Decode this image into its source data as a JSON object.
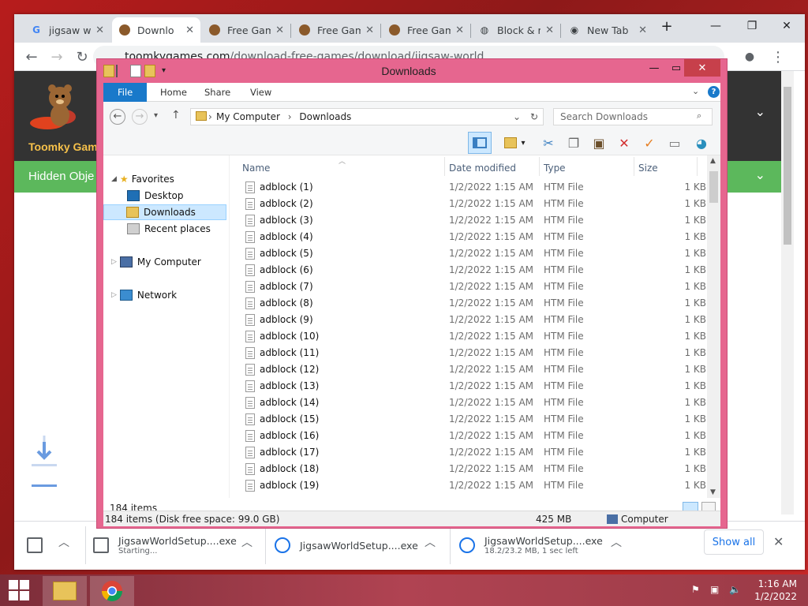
{
  "browser": {
    "tabs": [
      {
        "title": "jigsaw w",
        "icon": "google-icon"
      },
      {
        "title": "Downlo",
        "icon": "bear-icon"
      },
      {
        "title": "Free Gam",
        "icon": "bear-icon"
      },
      {
        "title": "Free Gam",
        "icon": "bear-icon"
      },
      {
        "title": "Free Gam",
        "icon": "bear-icon"
      },
      {
        "title": "Block & r",
        "icon": "globe-icon"
      },
      {
        "title": "New Tab",
        "icon": "chrome-icon"
      }
    ],
    "url_host": "toomkygames.com",
    "url_path": "/download-free-games/download/jigsaw-world",
    "site_name": "Toomky Gam",
    "site_nav_label": "Hidden Obje"
  },
  "downloads_shelf": {
    "items": [
      {
        "name": "JigsawWorldSetup....exe",
        "status": "Starting..."
      },
      {
        "name": "JigsawWorldSetup....exe",
        "status": ""
      },
      {
        "name": "JigsawWorldSetup....exe",
        "status": "18.2/23.2 MB, 1 sec left"
      }
    ],
    "show_all_label": "Show all"
  },
  "explorer": {
    "title": "Downloads",
    "ribbon_tabs": [
      "File",
      "Home",
      "Share",
      "View"
    ],
    "breadcrumb": [
      "My Computer",
      "Downloads"
    ],
    "search_placeholder": "Search Downloads",
    "nav": {
      "favorites": "Favorites",
      "desktop": "Desktop",
      "downloads": "Downloads",
      "recent": "Recent places",
      "computer": "My Computer",
      "network": "Network"
    },
    "columns": {
      "name": "Name",
      "date": "Date modified",
      "type": "Type",
      "size": "Size"
    },
    "files": [
      {
        "name": "adblock (1)",
        "date": "1/2/2022 1:15 AM",
        "type": "HTM File",
        "size": "1 KB"
      },
      {
        "name": "adblock (2)",
        "date": "1/2/2022 1:15 AM",
        "type": "HTM File",
        "size": "1 KB"
      },
      {
        "name": "adblock (3)",
        "date": "1/2/2022 1:15 AM",
        "type": "HTM File",
        "size": "1 KB"
      },
      {
        "name": "adblock (4)",
        "date": "1/2/2022 1:15 AM",
        "type": "HTM File",
        "size": "1 KB"
      },
      {
        "name": "adblock (5)",
        "date": "1/2/2022 1:15 AM",
        "type": "HTM File",
        "size": "1 KB"
      },
      {
        "name": "adblock (6)",
        "date": "1/2/2022 1:15 AM",
        "type": "HTM File",
        "size": "1 KB"
      },
      {
        "name": "adblock (7)",
        "date": "1/2/2022 1:15 AM",
        "type": "HTM File",
        "size": "1 KB"
      },
      {
        "name": "adblock (8)",
        "date": "1/2/2022 1:15 AM",
        "type": "HTM File",
        "size": "1 KB"
      },
      {
        "name": "adblock (9)",
        "date": "1/2/2022 1:15 AM",
        "type": "HTM File",
        "size": "1 KB"
      },
      {
        "name": "adblock (10)",
        "date": "1/2/2022 1:15 AM",
        "type": "HTM File",
        "size": "1 KB"
      },
      {
        "name": "adblock (11)",
        "date": "1/2/2022 1:15 AM",
        "type": "HTM File",
        "size": "1 KB"
      },
      {
        "name": "adblock (12)",
        "date": "1/2/2022 1:15 AM",
        "type": "HTM File",
        "size": "1 KB"
      },
      {
        "name": "adblock (13)",
        "date": "1/2/2022 1:15 AM",
        "type": "HTM File",
        "size": "1 KB"
      },
      {
        "name": "adblock (14)",
        "date": "1/2/2022 1:15 AM",
        "type": "HTM File",
        "size": "1 KB"
      },
      {
        "name": "adblock (15)",
        "date": "1/2/2022 1:15 AM",
        "type": "HTM File",
        "size": "1 KB"
      },
      {
        "name": "adblock (16)",
        "date": "1/2/2022 1:15 AM",
        "type": "HTM File",
        "size": "1 KB"
      },
      {
        "name": "adblock (17)",
        "date": "1/2/2022 1:15 AM",
        "type": "HTM File",
        "size": "1 KB"
      },
      {
        "name": "adblock (18)",
        "date": "1/2/2022 1:15 AM",
        "type": "HTM File",
        "size": "1 KB"
      },
      {
        "name": "adblock (19)",
        "date": "1/2/2022 1:15 AM",
        "type": "HTM File",
        "size": "1 KB"
      }
    ],
    "item_count": "184 items",
    "status_detail": "184 items (Disk free space: 99.0 GB)",
    "status_size": "425 MB",
    "status_location": "Computer"
  },
  "taskbar": {
    "time": "1:16 AM",
    "date": "1/2/2022"
  },
  "colors": {
    "explorer_frame": "#e6668f",
    "file_tab": "#1979ca",
    "site_nav": "#5cb85c",
    "taskbar": "#b04352"
  }
}
